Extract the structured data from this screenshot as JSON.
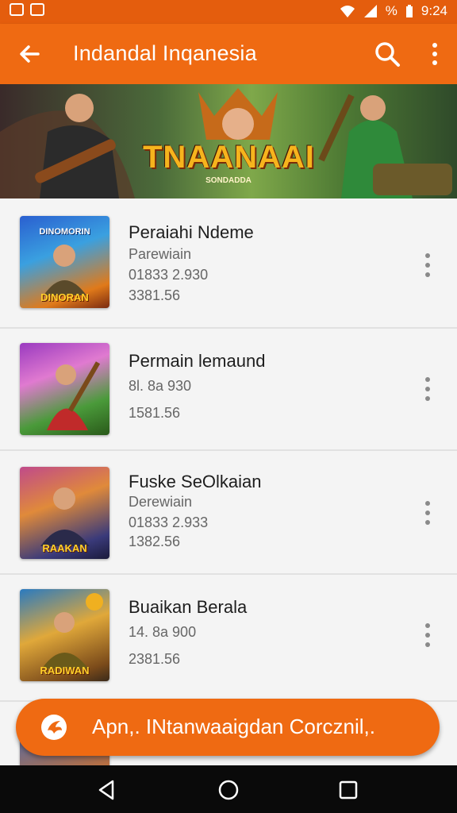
{
  "status_bar": {
    "time": "9:24",
    "battery": "%",
    "icons": [
      "notification-icon",
      "mail-icon",
      "wifi-icon",
      "signal-icon",
      "battery-icon"
    ]
  },
  "app_bar": {
    "title": "Indandal Inqanesia",
    "icons": [
      "back-arrow-icon",
      "search-icon",
      "more-vert-icon"
    ]
  },
  "banner": {
    "logo_text": "TNAANAAI",
    "sub_text": "SONDADDA"
  },
  "list": {
    "items": [
      {
        "title": "Peraiahi Ndeme",
        "line2": "Parewiain",
        "line3": "01833 2.930",
        "line4": "3381.56",
        "thumb_caption": "DINORAN",
        "thumb_top": "DINOMORIN"
      },
      {
        "title": "Permain lemaund",
        "line2": "",
        "line3": "8l.  8a  930",
        "line4": "1581.56",
        "thumb_caption": "",
        "thumb_top": ""
      },
      {
        "title": "Fuske SeOlkaian",
        "line2": "Derewiain",
        "line3": "01833 2.933",
        "line4": "1382.56",
        "thumb_caption": "RAAKAN",
        "thumb_top": ""
      },
      {
        "title": "Buaikan Berala",
        "line2": "",
        "line3": "14.  8a  900",
        "line4": "2381.56",
        "thumb_caption": "RADIWAN",
        "thumb_top": ""
      }
    ]
  },
  "fab": {
    "label": "Apn,. INtanwaaigdan Corcznil,."
  },
  "nav_bar": {
    "icons": [
      "back-triangle-icon",
      "home-circle-icon",
      "recents-square-icon"
    ]
  },
  "colors": {
    "accent": "#ef6a12",
    "status_bar": "#e45d0d",
    "background": "#f4f4f4"
  }
}
